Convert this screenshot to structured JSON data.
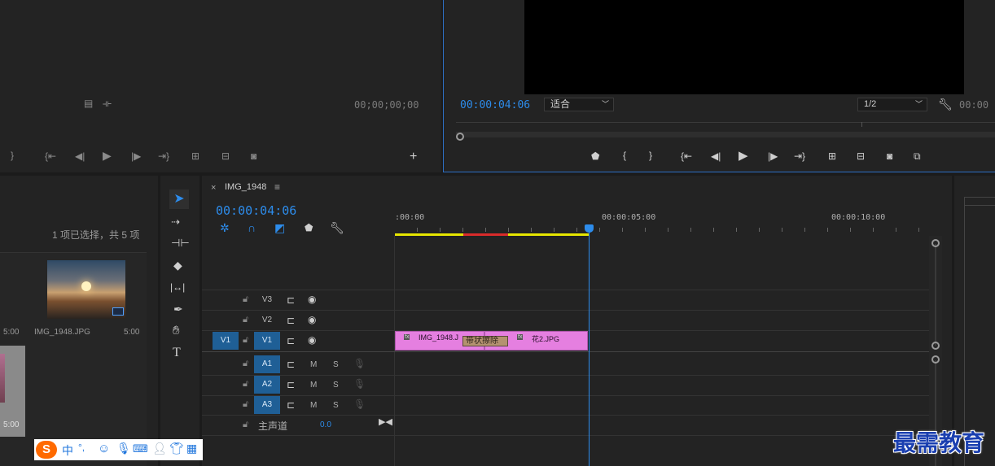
{
  "source_monitor": {
    "timecode": "00;00;00;00",
    "controls": [
      "mark-in-icon",
      "go-to-in-icon",
      "step-back-icon",
      "play-icon",
      "step-forward-icon",
      "go-to-out-icon",
      "insert-icon",
      "overwrite-icon",
      "export-frame-icon",
      "add-button-icon"
    ]
  },
  "program_monitor": {
    "timecode": "00:00:04:06",
    "fit_select": "适合",
    "resolution_select": "1/2",
    "duration": "00:00"
  },
  "project_panel": {
    "selection_text": "1 项已选择，共 5 项",
    "items": [
      {
        "name": "IMG_1948.JPG",
        "duration": "5:00"
      }
    ],
    "left_durations": [
      "5:00",
      "5:00"
    ]
  },
  "tools": [
    "selection-tool-icon",
    "track-select-tool-icon",
    "ripple-edit-tool-icon",
    "razor-tool-icon",
    "slip-tool-icon",
    "pen-tool-icon",
    "hand-tool-icon",
    "type-tool-icon"
  ],
  "timeline": {
    "tab_close": "×",
    "tab_title": "IMG_1948",
    "tab_menu": "≡",
    "timecode": "00:00:04:06",
    "ruler": [
      ":00:00",
      "00:00:05:00",
      "00:00:10:00"
    ],
    "video_tracks": [
      {
        "source": "",
        "name": "V3"
      },
      {
        "source": "",
        "name": "V2"
      },
      {
        "source": "V1",
        "name": "V1"
      }
    ],
    "audio_tracks": [
      {
        "name": "A1",
        "m": "M",
        "s": "S"
      },
      {
        "name": "A2",
        "m": "M",
        "s": "S"
      },
      {
        "name": "A3",
        "m": "M",
        "s": "S"
      }
    ],
    "master_label": "主声道",
    "master_value": "0.0",
    "clips": {
      "clip1": "IMG_1948.J",
      "transition": "带状擦除",
      "clip2": "花2.JPG",
      "fx": "fx"
    }
  },
  "ime_toolbar": {
    "logo": "S",
    "lang": "中",
    "punct": "°,"
  },
  "watermark": "最需教育",
  "colors": {
    "accent_blue": "#2d8ceb",
    "clip_pink": "#e57fe0",
    "track_target": "#1f5f96",
    "work_area_yellow": "#e6e600",
    "render_red": "#d92b2b"
  }
}
